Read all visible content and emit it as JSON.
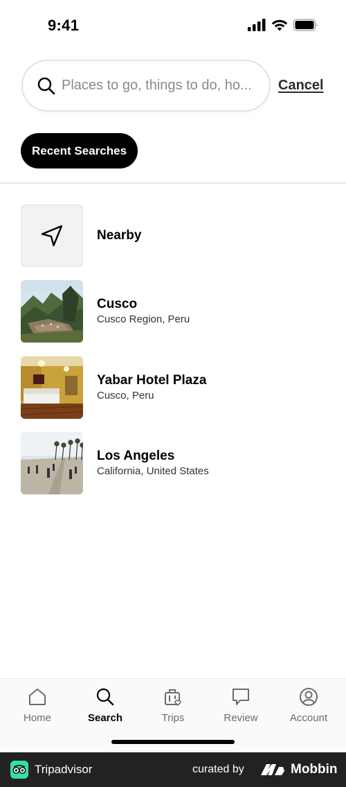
{
  "status_bar": {
    "time": "9:41"
  },
  "search": {
    "placeholder": "Places to go, things to do, ho...",
    "cancel_label": "Cancel"
  },
  "recent_searches_label": "Recent Searches",
  "list": {
    "nearby": {
      "title": "Nearby"
    },
    "items": [
      {
        "title": "Cusco",
        "subtitle": "Cusco Region, Peru"
      },
      {
        "title": "Yabar Hotel Plaza",
        "subtitle": "Cusco, Peru"
      },
      {
        "title": "Los Angeles",
        "subtitle": "California, United States"
      }
    ]
  },
  "nav": {
    "items": [
      {
        "label": "Home",
        "icon": "home-icon"
      },
      {
        "label": "Search",
        "icon": "search-icon",
        "active": true
      },
      {
        "label": "Trips",
        "icon": "trips-icon"
      },
      {
        "label": "Review",
        "icon": "review-icon"
      },
      {
        "label": "Account",
        "icon": "account-icon"
      }
    ]
  },
  "footer": {
    "brand": "Tripadvisor",
    "curated_by": "curated by",
    "mobbin": "Mobbin"
  },
  "colors": {
    "accent": "#000000",
    "tripadvisor_green": "#34e0a1",
    "footer_bg": "#222222"
  }
}
